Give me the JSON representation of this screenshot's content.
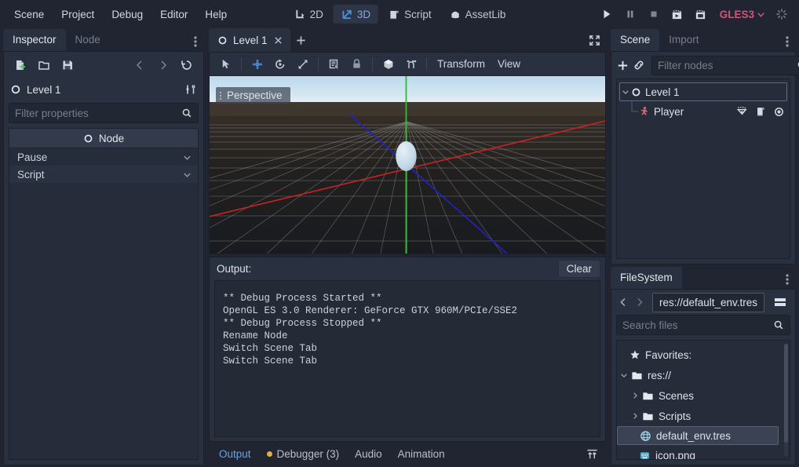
{
  "menu": {
    "items": [
      "Scene",
      "Project",
      "Debug",
      "Editor",
      "Help"
    ]
  },
  "modes": [
    {
      "label": "2D",
      "icon": "2d-icon",
      "active": false
    },
    {
      "label": "3D",
      "icon": "3d-icon",
      "active": true
    },
    {
      "label": "Script",
      "icon": "script-icon",
      "active": false
    },
    {
      "label": "AssetLib",
      "icon": "assetlib-icon",
      "active": false
    }
  ],
  "playback": {
    "play": "play-icon",
    "pause": "pause-icon",
    "stop": "stop-icon",
    "play_scene": "play-scene-icon",
    "play_custom": "play-custom-scene-icon",
    "renderer": "GLES3",
    "busy": "busy-spinner-icon"
  },
  "inspector": {
    "tabs": [
      {
        "label": "Inspector",
        "active": true
      },
      {
        "label": "Node",
        "active": false
      }
    ],
    "toolbar": {
      "new_resource": "new-resource-icon",
      "open_resource": "open-resource-icon",
      "save_resource": "save-resource-icon",
      "back": "back-arrow-icon",
      "forward": "forward-arrow-icon",
      "history": "history-icon",
      "object_menu": "object-tools-icon"
    },
    "object_name": "Level 1",
    "filter_placeholder": "Filter properties",
    "filter_value": "",
    "category": "Node",
    "properties": [
      {
        "label": "Pause",
        "control": "chevron-down-icon"
      },
      {
        "label": "Script",
        "control": "chevron-down-icon"
      }
    ]
  },
  "viewport": {
    "scene_tabs": [
      {
        "label": "Level 1",
        "active": true
      }
    ],
    "add_tab": "+",
    "fullscreen": "fullscreen-icon",
    "tools": [
      {
        "name": "select-mode-icon",
        "active": false
      },
      {
        "name": "move-mode-icon",
        "active": true
      },
      {
        "name": "rotate-mode-icon",
        "active": false
      },
      {
        "name": "scale-mode-icon",
        "active": false
      },
      {
        "name": "list-select-icon",
        "active": false
      },
      {
        "name": "lock-icon",
        "active": false
      },
      {
        "name": "local-space-icon",
        "active": false
      },
      {
        "name": "snap-mode-icon",
        "active": false
      }
    ],
    "menus": [
      "Transform",
      "View"
    ],
    "camera_label": "Perspective",
    "axis_colors": {
      "x": "#cc2222",
      "y": "#1fc81f",
      "z": "#2222c8"
    },
    "object_color": "#c3d9e8"
  },
  "output": {
    "title": "Output:",
    "clear_label": "Clear",
    "lines": [
      "** Debug Process Started **",
      "OpenGL ES 3.0 Renderer: GeForce GTX 960M/PCIe/SSE2",
      "** Debug Process Stopped **",
      "Rename Node",
      "Switch Scene Tab",
      "Switch Scene Tab"
    ],
    "bottom_tabs": [
      {
        "label": "Output",
        "active": true,
        "dot": false
      },
      {
        "label": "Debugger (3)",
        "active": false,
        "dot": true
      },
      {
        "label": "Audio",
        "active": false,
        "dot": false
      },
      {
        "label": "Animation",
        "active": false,
        "dot": false
      }
    ],
    "expand_icon": "expand-bottom-panel-icon"
  },
  "scene": {
    "tabs": [
      {
        "label": "Scene",
        "active": true
      },
      {
        "label": "Import",
        "active": false
      }
    ],
    "toolbar": {
      "add_node": "add-node-icon",
      "instance": "link-instance-icon"
    },
    "filter_placeholder": "Filter nodes",
    "filter_value": "",
    "nodes": [
      {
        "name": "Level 1",
        "icon": "spatial-node-icon",
        "selected": true,
        "expanded": true,
        "depth": 0,
        "row_icons": []
      },
      {
        "name": "Player",
        "icon": "kinematic-body-icon",
        "selected": false,
        "expanded": false,
        "depth": 1,
        "row_icons": [
          "groups-icon",
          "script-attached-icon",
          "visibility-eye-icon"
        ]
      }
    ]
  },
  "filesystem": {
    "tabs": [
      {
        "label": "FileSystem",
        "active": true
      }
    ],
    "nav": {
      "back": "nav-back-icon",
      "forward": "nav-forward-icon",
      "split": "split-mode-icon"
    },
    "path_value": "res://default_env.tres",
    "search_placeholder": "Search files",
    "search_value": "",
    "entries": [
      {
        "name": "Favorites:",
        "icon": "star-icon",
        "depth": 0,
        "type": "header",
        "selected": false,
        "arrow": ""
      },
      {
        "name": "res://",
        "icon": "folder-icon",
        "depth": 0,
        "type": "folder",
        "selected": false,
        "arrow": "open"
      },
      {
        "name": "Scenes",
        "icon": "folder-icon",
        "depth": 1,
        "type": "folder",
        "selected": false,
        "arrow": "closed"
      },
      {
        "name": "Scripts",
        "icon": "folder-icon",
        "depth": 1,
        "type": "folder",
        "selected": false,
        "arrow": "closed"
      },
      {
        "name": "default_env.tres",
        "icon": "environment-icon",
        "depth": 1,
        "type": "file",
        "selected": true,
        "arrow": ""
      },
      {
        "name": "icon.png",
        "icon": "godot-icon",
        "depth": 1,
        "type": "file",
        "selected": false,
        "arrow": ""
      }
    ]
  },
  "colors": {
    "accent": "#71a0e0",
    "panel": "#293040",
    "background": "#202531",
    "renderer_text": "#c85a78",
    "warning_dot": "#e0b040"
  }
}
